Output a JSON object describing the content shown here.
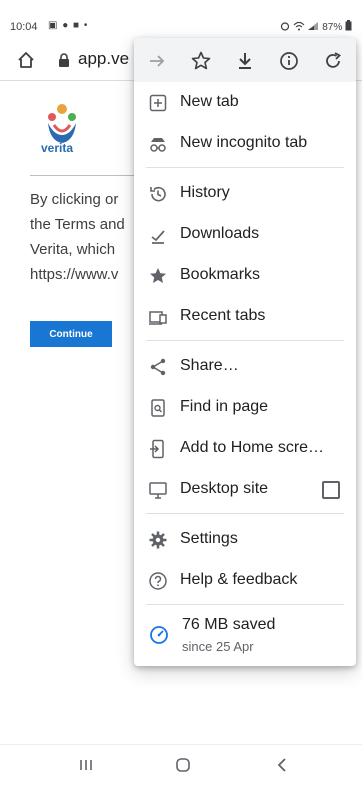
{
  "status_bar": {
    "time": "10:04",
    "left_icons": "▣ ● ■ •",
    "battery": "87%"
  },
  "toolbar": {
    "url": "app.ve"
  },
  "page": {
    "logo_text": "verita",
    "body_lines": [
      "By clicking or",
      "the Terms and",
      "Verita, which",
      "https://www.v"
    ],
    "continue_label": "Continue",
    "continue_color": "#1976d2"
  },
  "menu": {
    "items": [
      {
        "label": "New tab",
        "icon": "new-tab-icon"
      },
      {
        "label": "New incognito tab",
        "icon": "incognito-icon"
      },
      {
        "label": "History",
        "icon": "history-icon"
      },
      {
        "label": "Downloads",
        "icon": "downloads-icon"
      },
      {
        "label": "Bookmarks",
        "icon": "bookmarks-icon"
      },
      {
        "label": "Recent tabs",
        "icon": "recent-tabs-icon"
      },
      {
        "label": "Share…",
        "icon": "share-icon"
      },
      {
        "label": "Find in page",
        "icon": "find-in-page-icon"
      },
      {
        "label": "Add to Home scre…",
        "icon": "add-to-home-icon"
      },
      {
        "label": "Desktop site",
        "icon": "desktop-site-icon",
        "checked": false
      },
      {
        "label": "Settings",
        "icon": "settings-icon"
      },
      {
        "label": "Help & feedback",
        "icon": "help-icon"
      }
    ],
    "data_saved": {
      "title": "76 MB saved",
      "subtitle": "since 25 Apr"
    },
    "accent": "#1a73e8"
  }
}
